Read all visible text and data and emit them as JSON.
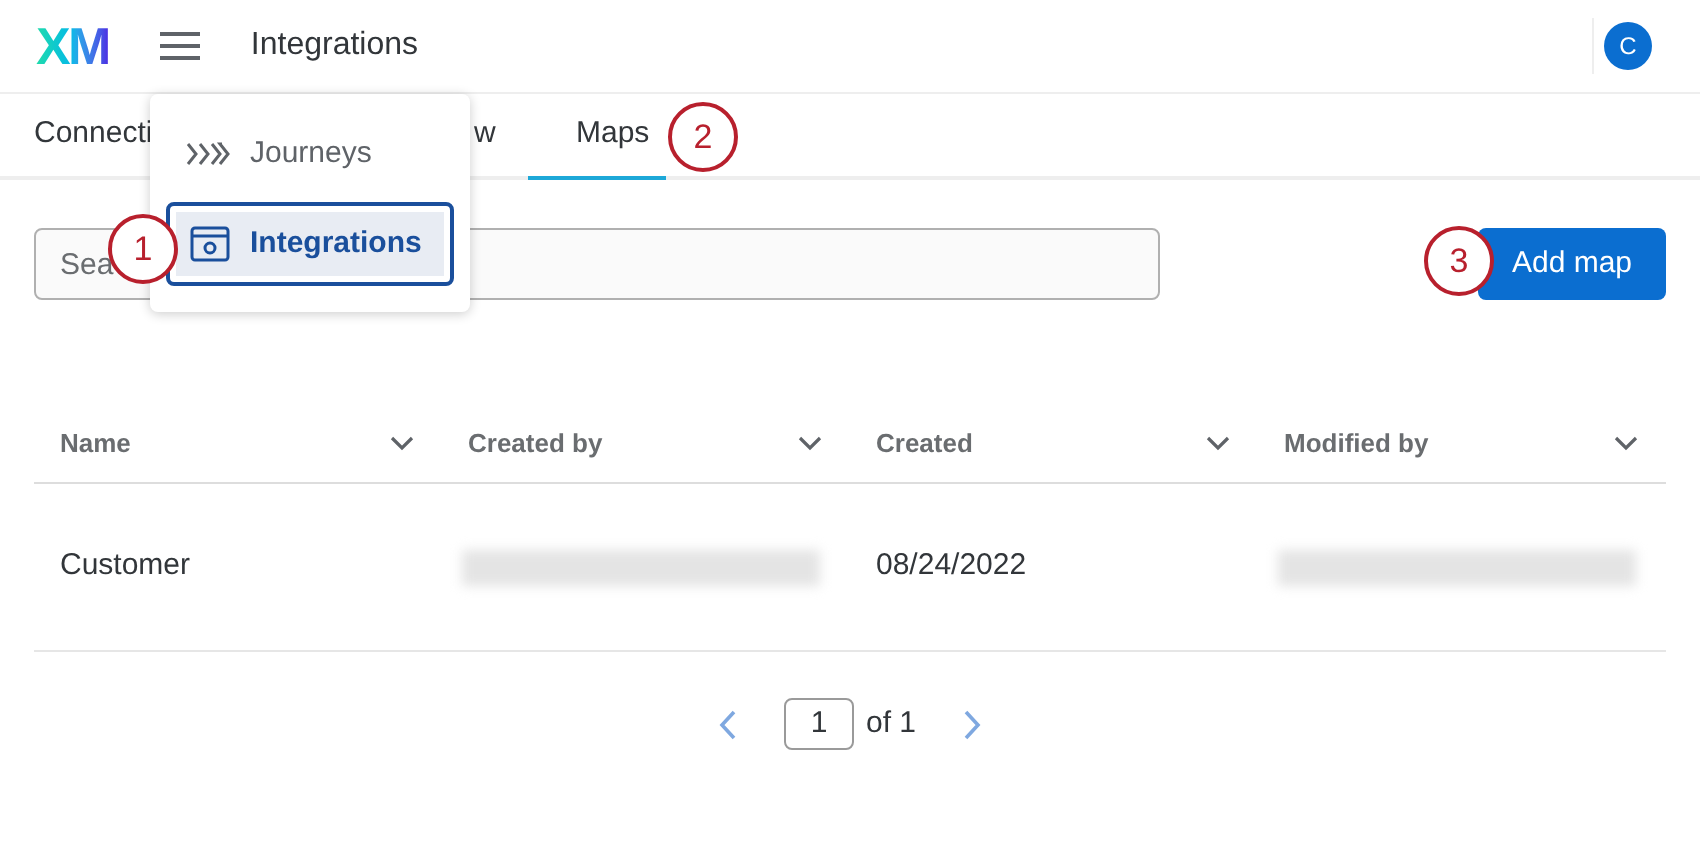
{
  "header": {
    "logo": "XM",
    "title": "Integrations",
    "avatar": "C"
  },
  "tabs": [
    {
      "label": "Connecti",
      "selected": false
    },
    {
      "label": "w",
      "selected": false
    },
    {
      "label": "Maps",
      "selected": true
    }
  ],
  "menu": {
    "items": [
      {
        "label": "Journeys",
        "kind": "journeys",
        "selected": false
      },
      {
        "label": "Integrations",
        "kind": "integrations",
        "selected": true
      }
    ]
  },
  "search": {
    "placeholder": "Sea"
  },
  "add_button": "Add map",
  "table": {
    "columns": [
      "Name",
      "Created by",
      "Created",
      "Modified by"
    ],
    "rows": [
      {
        "cells": [
          {
            "kind": "text",
            "text": "Customer"
          },
          {
            "kind": "blurred"
          },
          {
            "kind": "text",
            "text": "08/24/2022"
          },
          {
            "kind": "blurred"
          }
        ]
      }
    ]
  },
  "pagination": {
    "page": "1",
    "of": "of 1"
  },
  "callouts": [
    "1",
    "2",
    "3"
  ]
}
